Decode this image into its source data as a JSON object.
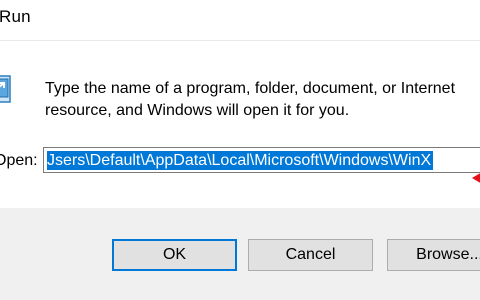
{
  "window": {
    "title": "Run"
  },
  "dialog": {
    "description_line1": "Type the name of a program, folder, document, or Internet",
    "description_line2": "resource, and Windows will open it for you.",
    "open_label": "Open:",
    "open_value": "C:\\Users\\Default\\AppData\\Local\\Microsoft\\Windows\\WinX",
    "open_value_visible": "Jsers\\Default\\AppData\\Local\\Microsoft\\Windows\\WinX"
  },
  "buttons": {
    "ok": "OK",
    "cancel": "Cancel",
    "browse": "Browse..."
  },
  "icons": {
    "run": "run-app-icon",
    "annotation": "red-arrow-annotation"
  },
  "colors": {
    "selection": "#0078d7",
    "annotation": "#e8101a",
    "footer": "#f0f0f0"
  }
}
